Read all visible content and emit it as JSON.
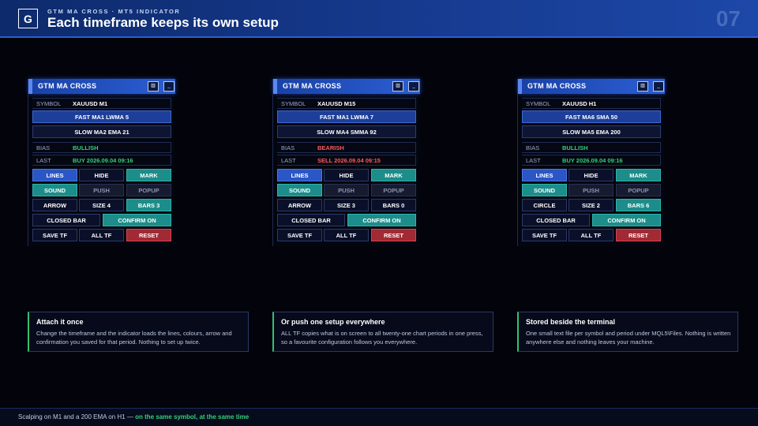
{
  "header": {
    "logo": "G",
    "kicker": "GTM MA CROSS · MT5 INDICATOR",
    "title": "Each timeframe keeps its own setup",
    "page_number": "07"
  },
  "panels": [
    {
      "title": "GTM MA CROSS",
      "max_btn": "▥",
      "min_btn": "_",
      "symbol_label": "SYMBOL",
      "symbol": "XAUUSD M1",
      "fast": "FAST MA1 LWMA 5",
      "slow": "SLOW MA2 EMA 21",
      "bias_label": "BIAS",
      "bias": "BULLISH",
      "last_label": "LAST",
      "last": "BUY 2026.09.04 09:16",
      "lines": "LINES",
      "hide": "HIDE",
      "mark": "MARK",
      "sound": "SOUND",
      "push": "PUSH",
      "popup": "POPUP",
      "shape": "ARROW",
      "size": "SIZE 4",
      "bars": "BARS 3",
      "closed": "CLOSED BAR",
      "confirm": "CONFIRM ON",
      "save": "SAVE TF",
      "alltf": "ALL TF",
      "reset": "RESET"
    },
    {
      "title": "GTM MA CROSS",
      "max_btn": "▥",
      "min_btn": "_",
      "symbol_label": "SYMBOL",
      "symbol": "XAUUSD M15",
      "fast": "FAST MA1 LWMA 7",
      "slow": "SLOW MA4 SMMA 92",
      "bias_label": "BIAS",
      "bias": "BEARISH",
      "last_label": "LAST",
      "last": "SELL 2026.09.04 09:15",
      "lines": "LINES",
      "hide": "HIDE",
      "mark": "MARK",
      "sound": "SOUND",
      "push": "PUSH",
      "popup": "POPUP",
      "shape": "ARROW",
      "size": "SIZE 3",
      "bars": "BARS 0",
      "closed": "CLOSED BAR",
      "confirm": "CONFIRM ON",
      "save": "SAVE TF",
      "alltf": "ALL TF",
      "reset": "RESET"
    },
    {
      "title": "GTM MA CROSS",
      "max_btn": "▥",
      "min_btn": "_",
      "symbol_label": "SYMBOL",
      "symbol": "XAUUSD H1",
      "fast": "FAST MA6 SMA 50",
      "slow": "SLOW MA5 EMA 200",
      "bias_label": "BIAS",
      "bias": "BULLISH",
      "last_label": "LAST",
      "last": "BUY 2026.09.04 09:16",
      "lines": "LINES",
      "hide": "HIDE",
      "mark": "MARK",
      "sound": "SOUND",
      "push": "PUSH",
      "popup": "POPUP",
      "shape": "CIRCLE",
      "size": "SIZE 2",
      "bars": "BARS 6",
      "closed": "CLOSED BAR",
      "confirm": "CONFIRM ON",
      "save": "SAVE TF",
      "alltf": "ALL TF",
      "reset": "RESET"
    }
  ],
  "cards": [
    {
      "title": "Attach it once",
      "body": "Change the timeframe and the indicator loads the lines, colours, arrow and confirmation you saved for that period. Nothing to set up twice."
    },
    {
      "title": "Or push one setup everywhere",
      "body": "ALL TF copies what is on screen to all twenty-one chart periods in one press, so a favourite configuration follows you everywhere."
    },
    {
      "title": "Stored beside the terminal",
      "body": "One small text file per symbol and period under MQL5\\Files. Nothing is written anywhere else and nothing leaves your machine."
    }
  ],
  "footer": {
    "text": "Scalping on M1 and a 200 EMA on H1 — ",
    "highlight": "on the same symbol, at the same time"
  },
  "colors": {
    "bullish": "#35d07a",
    "bearish": "#ff5a5a",
    "accent_blue": "#2a56c6",
    "teal": "#1c8d8a",
    "red": "#a12a34"
  }
}
